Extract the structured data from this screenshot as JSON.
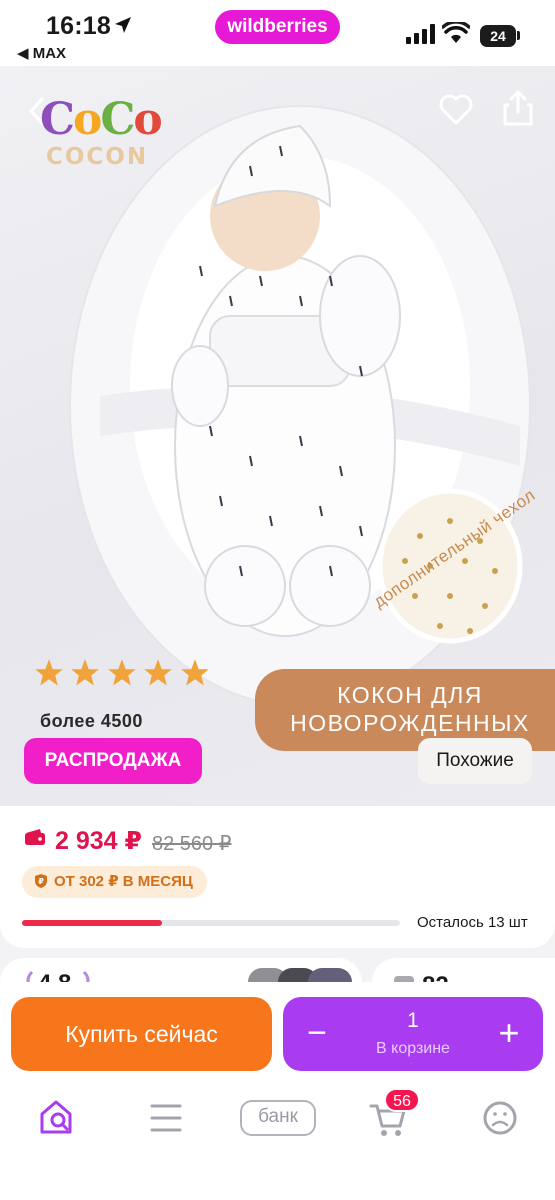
{
  "status_bar": {
    "time": "16:18",
    "back_app": "◀ MAX",
    "brand": "wildberries",
    "battery": "24"
  },
  "hero": {
    "logo_main": [
      "C",
      "o",
      "C",
      "o"
    ],
    "logo_sub": "COCON",
    "rating_stars": 5,
    "reviews_count": "более 4500",
    "sale_badge": "РАСПРОДАЖА",
    "title_line1": "КОКОН ДЛЯ",
    "title_line2": "НОВОРОЖДЕННЫХ",
    "swatch_label": "дополнительный чехол",
    "similar_button": "Похожие"
  },
  "price_card": {
    "price": "2 934 ₽",
    "old_price": "82 560 ₽",
    "installment": "ОТ 302 ₽ В МЕСЯЦ",
    "stock_text": "Осталось 13 шт",
    "stock_level": 0.37
  },
  "next_cards": {
    "rating": "4.8",
    "questions": "82"
  },
  "actions": {
    "buy_now": "Купить сейчас",
    "cart_qty": "1",
    "cart_label": "В корзине",
    "minus": "−",
    "plus": "+"
  },
  "tabbar": {
    "bank": "банк",
    "cart_badge": "56"
  },
  "colors": {
    "brand": "#e619d6",
    "price": "#e0134d",
    "buy": "#f7761b",
    "cart": "#a93bf0"
  }
}
